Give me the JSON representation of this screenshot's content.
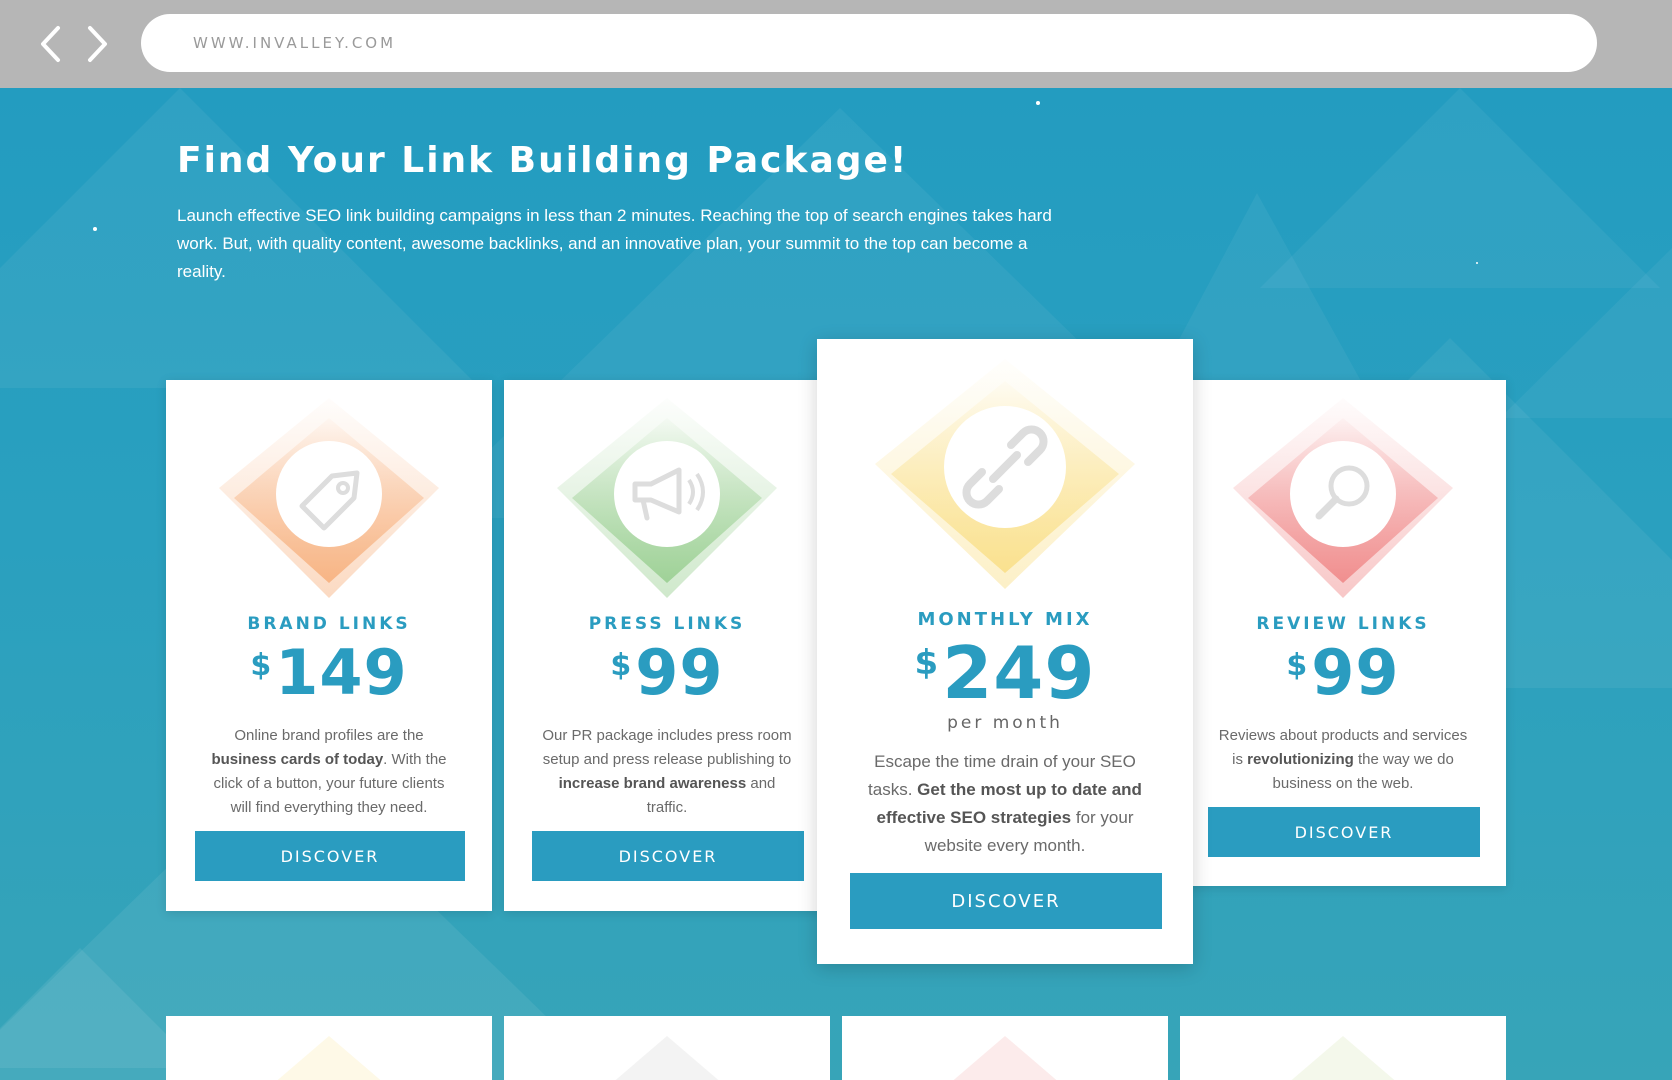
{
  "browser": {
    "url": "WWW.INVALLEY.COM",
    "back_icon": "chevron-left-icon",
    "forward_icon": "chevron-right-icon"
  },
  "hero": {
    "title": "Find Your Link Building Package!",
    "intro": "Launch effective SEO link building campaigns in less than 2 minutes. Reaching the top of search engines takes hard work. But, with quality content, awesome backlinks, and an innovative plan, your summit to the top can become a reality."
  },
  "cards": [
    {
      "title": "BRAND LINKS",
      "currency": "$",
      "price": "149",
      "icon": "price-tag-icon",
      "color": "#f6a870",
      "desc_parts": [
        "Online brand profiles are the ",
        "business cards of today",
        ". With the click of a button, your future clients will find everything they need."
      ],
      "button": "DISCOVER"
    },
    {
      "title": "PRESS LINKS",
      "currency": "$",
      "price": "99",
      "icon": "megaphone-icon",
      "color": "#8fca86",
      "desc_parts": [
        "Our PR package includes press room setup and press release publishing to ",
        "increase brand awareness",
        " and traffic."
      ],
      "button": "DISCOVER"
    },
    {
      "title": "MONTHLY MIX",
      "currency": "$",
      "price": "249",
      "period": "per month",
      "icon": "chain-link-icon",
      "color": "#f9dc7c",
      "desc_parts": [
        "Escape the time drain of your SEO tasks. ",
        "Get the most up to date and effective SEO strategies",
        " for your website every month."
      ],
      "button": "DISCOVER"
    },
    {
      "title": "REVIEW LINKS",
      "currency": "$",
      "price": "99",
      "icon": "magnifier-icon",
      "color": "#ee7c7c",
      "desc_parts": [
        "Reviews about products and services is ",
        "revolutionizing",
        " the way we do business on the web."
      ],
      "button": "DISCOVER"
    }
  ]
}
